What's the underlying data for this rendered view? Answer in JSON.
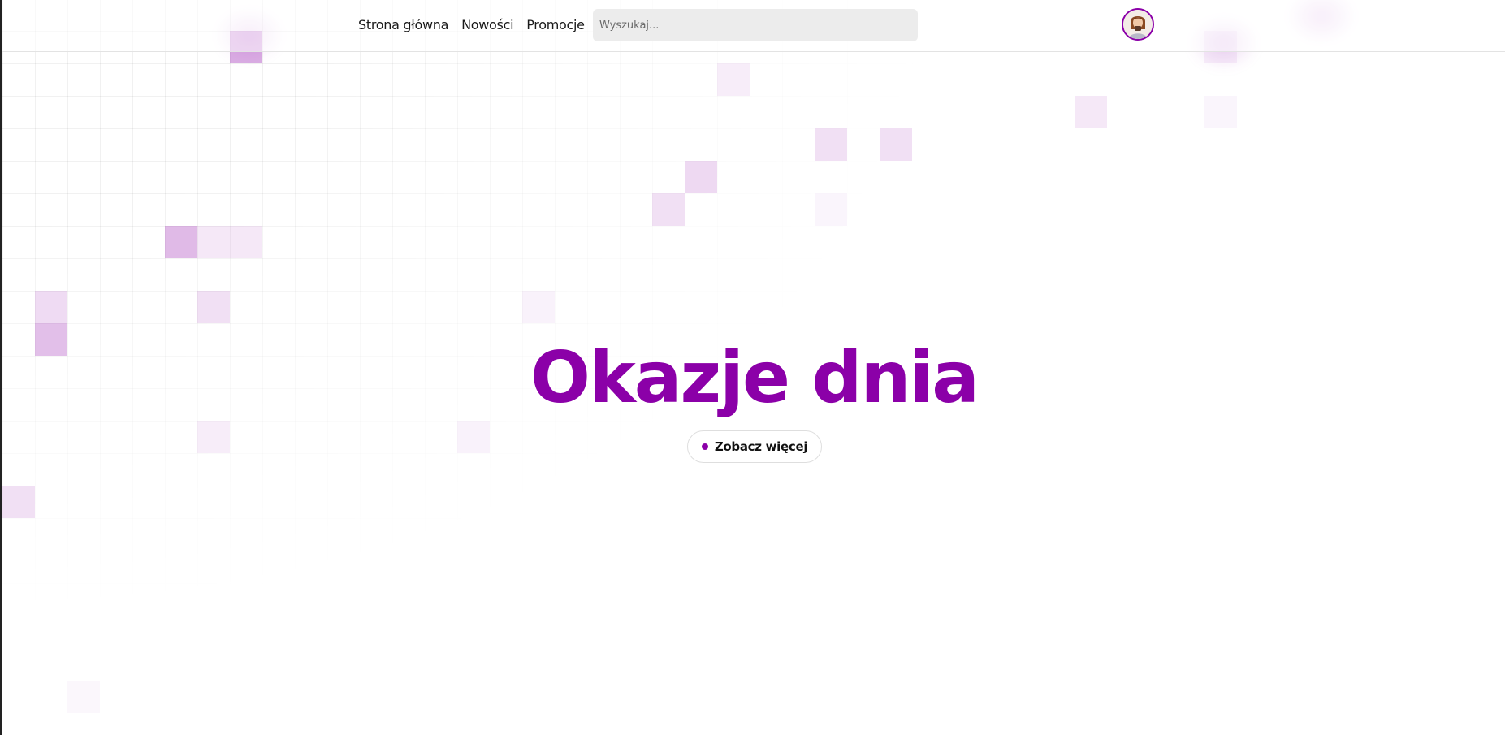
{
  "nav": {
    "items": [
      {
        "label": "Strona główna"
      },
      {
        "label": "Nowości"
      },
      {
        "label": "Promocje"
      }
    ]
  },
  "search": {
    "placeholder": "Wyszukaj..."
  },
  "user": {
    "avatar_icon": "user-avatar-icon"
  },
  "hero": {
    "title": "Okazje dnia",
    "cta_label": "Zobacz więcej"
  },
  "colors": {
    "accent": "#8b00a8",
    "search_bg": "#ececec",
    "grid_line": "#ebebeb",
    "page_bg": "#ffffff"
  }
}
